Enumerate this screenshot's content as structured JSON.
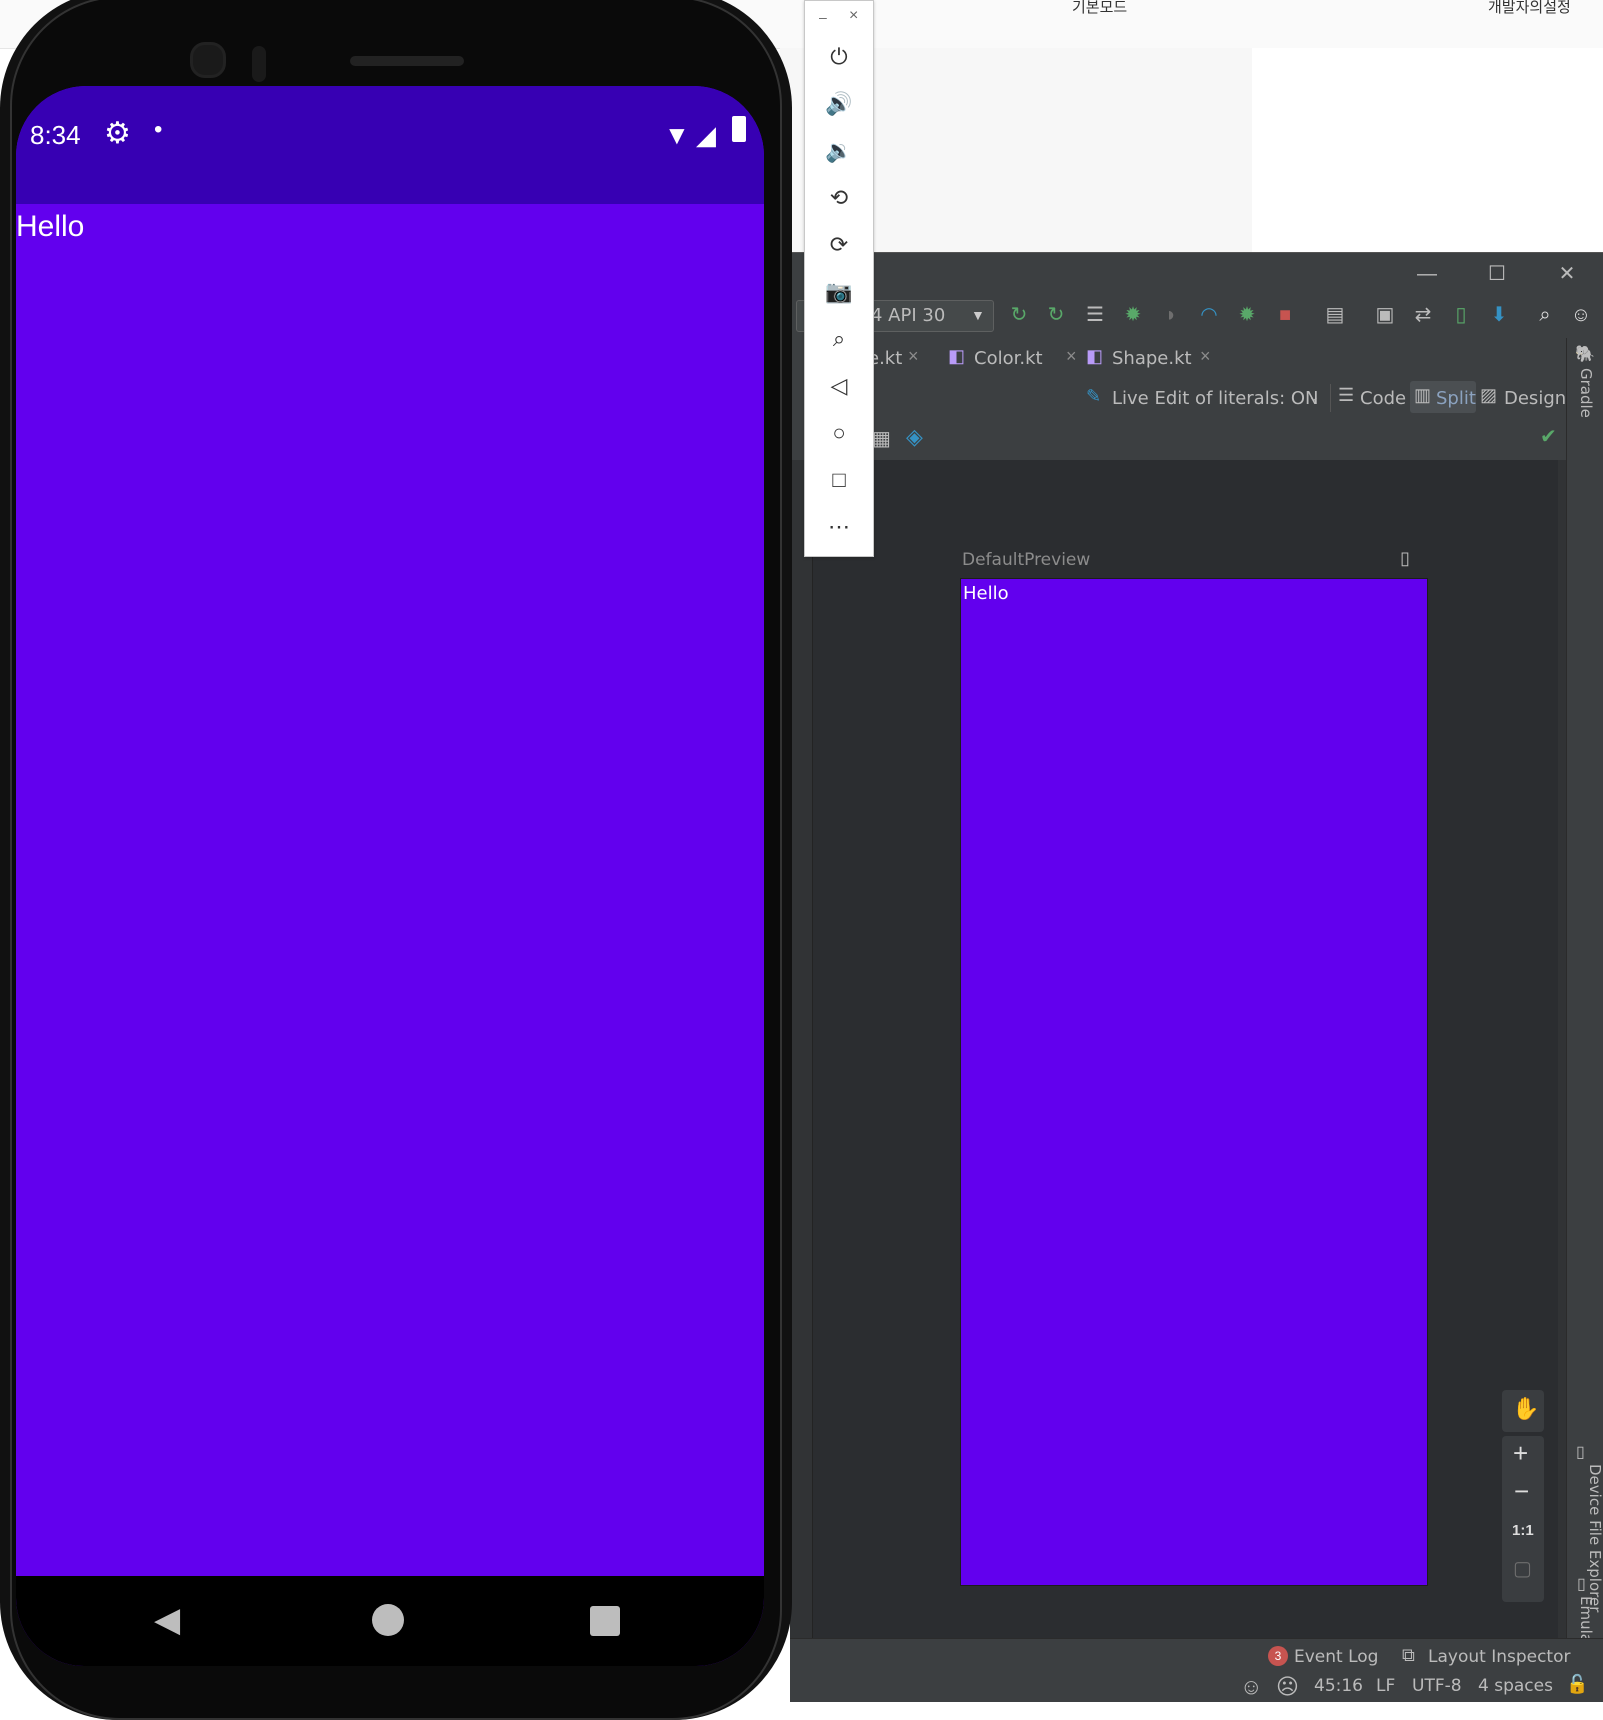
{
  "background": {
    "top_text_right": "개발자의설정",
    "top_text_mid": "기본모드"
  },
  "emulator_toolbar": {
    "minimize": "–",
    "close": "×",
    "buttons": [
      "power-icon",
      "volume-up-icon",
      "volume-down-icon",
      "rotate-left-icon",
      "rotate-right-icon",
      "camera-icon",
      "zoom-icon",
      "back-icon",
      "home-icon",
      "overview-icon",
      "more-icon"
    ]
  },
  "phone": {
    "time": "8:34",
    "hello": "Hello",
    "colors": {
      "primary": "#6200ee",
      "primary_dark": "#3700b3"
    }
  },
  "ide": {
    "device_selector": "4 API 30",
    "tabs": [
      {
        "label": "e.kt"
      },
      {
        "label": "Color.kt"
      },
      {
        "label": "Shape.kt"
      }
    ],
    "live_edit": "Live Edit of literals: ON",
    "modes": {
      "code": "Code",
      "split": "Split",
      "design": "Design"
    },
    "gradle": "Gradle",
    "preview_label": "DefaultPreview",
    "preview_hello": "Hello",
    "zoom": {
      "plus": "+",
      "minus": "−",
      "one_to_one": "1:1"
    },
    "side_tools": {
      "emulator": "Emulator",
      "device_file_explorer": "Device File Explorer"
    },
    "bottom": {
      "event_log_count": "3",
      "event_log": "Event Log",
      "layout_inspector": "Layout Inspector"
    },
    "status": {
      "position": "45:16",
      "line_sep": "LF",
      "encoding": "UTF-8",
      "indent": "4 spaces"
    }
  }
}
